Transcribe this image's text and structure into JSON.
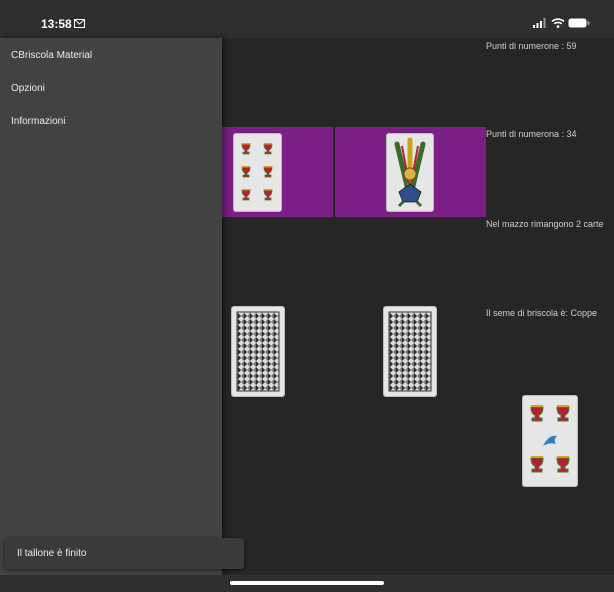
{
  "status_bar": {
    "time": "13:58",
    "icons": [
      "mail-icon",
      "signal-icon",
      "wifi-icon",
      "battery-icon"
    ]
  },
  "drawer": {
    "items": [
      {
        "label": "CBriscola Material"
      },
      {
        "label": "Opzioni"
      },
      {
        "label": "Informazioni"
      }
    ]
  },
  "info": {
    "points_numerone": "Punti di numerone  : 59",
    "points_numerona": "Punti di numerona  : 34",
    "deck_remaining": "Nel mazzo rimangono 2 carte",
    "briscola_suit": "Il seme di briscola è: Coppe"
  },
  "snackbar": {
    "message": "Il tallone è finito"
  },
  "cards": {
    "played_left": {
      "rank": 6,
      "suit": "Coppe"
    },
    "played_right": {
      "rank": "Fante",
      "suit": "Bastoni"
    },
    "hidden_hand": [
      "card-back",
      "card-back"
    ],
    "briscola_card": {
      "rank": 4,
      "suit": "Coppe"
    }
  },
  "colors": {
    "background": "#262626",
    "drawer": "#424242",
    "played_slot": "#7b1f86",
    "status_bar": "#2f2f2f"
  }
}
